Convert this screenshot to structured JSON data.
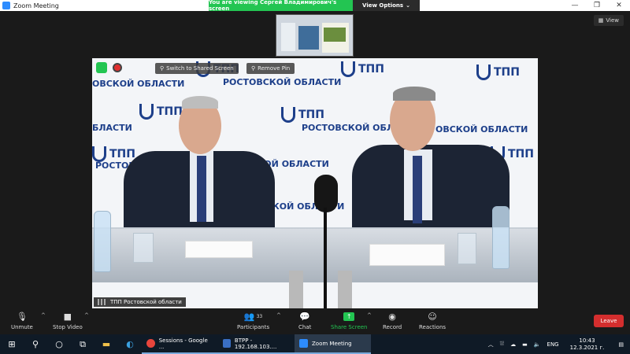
{
  "window": {
    "title": "Zoom Meeting",
    "minimize": "—",
    "maximize": "❐",
    "close": "✕"
  },
  "banner": {
    "viewing_text": "You are viewing Сергей Владимирович's screen",
    "options_label": "View Options",
    "options_caret": "⌄"
  },
  "stage": {
    "view_label": "View",
    "pin_bar": {
      "switch_label": "Switch to Shared Screen",
      "remove_pin_label": "Remove Pin"
    },
    "wall": {
      "org": "ТПП",
      "region": "РОСТОВСКОЙ ОБЛАСТИ",
      "region_short": "ОВСКОЙ ОБЛАСТИ",
      "region_left": "БЛАСТИ",
      "region_cut": "ТОВСКОЙ ОБЛАСТИ"
    },
    "participant_name": "ТПП Ростовской области"
  },
  "toolbar": {
    "unmute": "Unmute",
    "stop_video": "Stop Video",
    "participants": "Participants",
    "participants_count": "33",
    "chat": "Chat",
    "share_screen": "Share Screen",
    "record": "Record",
    "reactions": "Reactions",
    "leave": "Leave",
    "caret": "^"
  },
  "taskbar": {
    "apps": [
      {
        "label": "Sessions - Google ...",
        "color": "#e8453c"
      },
      {
        "label": "BTPP - 192.168.103....",
        "color": "#3a6fc4"
      },
      {
        "label": "Zoom Meeting",
        "color": "#2d8cff"
      }
    ],
    "lang": "ENG",
    "time": "10:43",
    "date": "12.3.2021 г."
  },
  "colors": {
    "share_green": "#23c552",
    "leave_red": "#d42e2e",
    "zoom_blue": "#2d8cff"
  }
}
